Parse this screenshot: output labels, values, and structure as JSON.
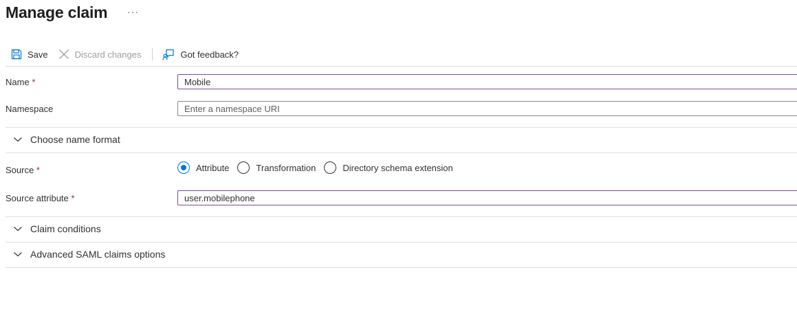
{
  "page": {
    "title": "Manage claim",
    "more_label": "···"
  },
  "toolbar": {
    "save_label": "Save",
    "discard_label": "Discard changes",
    "feedback_label": "Got feedback?"
  },
  "form": {
    "name": {
      "label": "Name",
      "required_mark": "*",
      "value": "Mobile"
    },
    "namespace": {
      "label": "Namespace",
      "placeholder": "Enter a namespace URI"
    },
    "name_format": {
      "label": "Choose name format"
    },
    "source": {
      "label": "Source",
      "required_mark": "*",
      "options": [
        "Attribute",
        "Transformation",
        "Directory schema extension"
      ],
      "selected": "Attribute"
    },
    "source_attribute": {
      "label": "Source attribute",
      "required_mark": "*",
      "value": "user.mobilephone"
    },
    "claim_conditions": {
      "label": "Claim conditions"
    },
    "advanced_saml": {
      "label": "Advanced SAML claims options"
    }
  },
  "colors": {
    "accent": "#0078d4",
    "focus_border": "#7a4a9e",
    "required": "#a4262c",
    "disabled_text": "#a19f9d"
  },
  "icons": [
    "save-icon",
    "close-icon",
    "feedback-icon",
    "chevron-down-icon"
  ]
}
